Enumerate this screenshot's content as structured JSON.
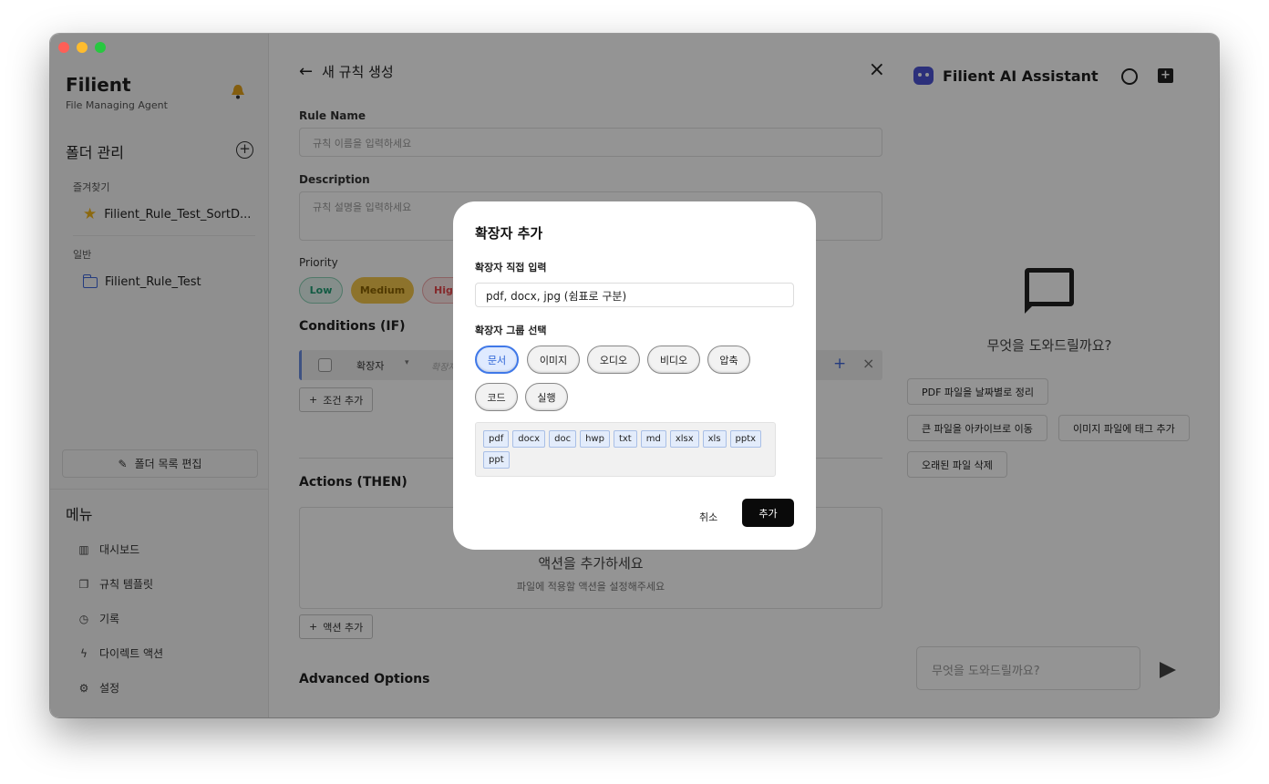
{
  "sidebar": {
    "brand_title": "Filient",
    "brand_sub": "File Managing Agent",
    "folder_section": "폴더 관리",
    "favorites_label": "즐겨찾기",
    "favorite_item": "Filient_Rule_Test_SortD...",
    "general_label": "일반",
    "general_item": "Filient_Rule_Test",
    "edit_folders": "폴더 목록 편집",
    "menu_title": "메뉴",
    "menu": [
      "대시보드",
      "규칙 템플릿",
      "기록",
      "다이렉트 액션",
      "설정"
    ]
  },
  "main": {
    "header_title": "새 규칙 생성",
    "rule_name_label": "Rule Name",
    "rule_name_placeholder": "규칙 이름을 입력하세요",
    "description_label": "Description",
    "description_placeholder": "규칙 설명을 입력하세요",
    "priority_label": "Priority",
    "priority_options": [
      "Low",
      "Medium",
      "High"
    ],
    "conditions_title": "Conditions (IF)",
    "condition_field": "확장자",
    "condition_value_placeholder": "확장자",
    "add_condition": "조건 추가",
    "actions_title": "Actions (THEN)",
    "actions_empty_title": "액션을 추가하세요",
    "actions_empty_sub": "파일에 적용할 액션을 설정해주세요",
    "add_action": "액션 추가",
    "advanced_title": "Advanced Options"
  },
  "assistant": {
    "title": "Filient AI Assistant",
    "prompt": "무엇을 도와드릴까요?",
    "suggestions": [
      "PDF 파일을 날짜별로 정리",
      "큰 파일을 아카이브로 이동",
      "이미지 파일에 태그 추가",
      "오래된 파일 삭제"
    ],
    "input_placeholder": "무엇을 도와드릴까요?"
  },
  "modal": {
    "title": "확장자 추가",
    "direct_input_label": "확장자 직접 입력",
    "direct_input_value": "pdf, docx, jpg (쉼표로 구분)",
    "group_label": "확장자 그룹 선택",
    "groups": [
      "문서",
      "이미지",
      "오디오",
      "비디오",
      "압축",
      "코드",
      "실행"
    ],
    "selected_group": "문서",
    "extensions": [
      "pdf",
      "docx",
      "doc",
      "hwp",
      "txt",
      "md",
      "xlsx",
      "xls",
      "pptx",
      "ppt"
    ],
    "cancel": "취소",
    "add": "추가"
  },
  "colors": {
    "accent_blue": "#3f78e8",
    "priority_low": "#1f9d74",
    "priority_medium": "#e6a800",
    "priority_high": "#e5484d",
    "assistant_icon": "#4c53d4"
  }
}
